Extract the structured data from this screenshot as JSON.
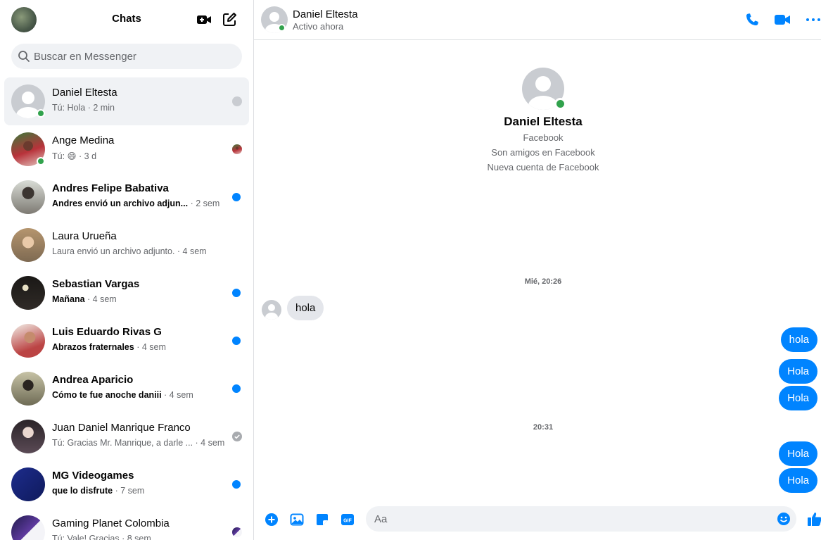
{
  "sidebar": {
    "title": "Chats",
    "search_placeholder": "Buscar en Messenger",
    "conversations": [
      {
        "name": "Daniel Eltesta",
        "message": "Tú: Hola",
        "time": "· 2 min",
        "online": true,
        "active": true,
        "unread": false,
        "status": "seen-avatar"
      },
      {
        "name": "Ange Medina",
        "message": "Tú: 😄",
        "time": "· 3 d",
        "online": true,
        "active": false,
        "unread": false,
        "status": "seen-avatar"
      },
      {
        "name": "Andres Felipe Babativa",
        "message": "Andres envió un archivo adjun...",
        "time": "· 2 sem",
        "online": false,
        "active": false,
        "unread": true,
        "status": "unread-dot"
      },
      {
        "name": "Laura Urueña",
        "message": "Laura envió un archivo adjunto.",
        "time": "· 4 sem",
        "online": false,
        "active": false,
        "unread": false,
        "status": "none"
      },
      {
        "name": "Sebastian Vargas",
        "message": "Mañana",
        "time": "· 4 sem",
        "online": false,
        "active": false,
        "unread": true,
        "status": "unread-dot"
      },
      {
        "name": "Luis Eduardo Rivas G",
        "message": "Abrazos fraternales",
        "time": "· 4 sem",
        "online": false,
        "active": false,
        "unread": true,
        "status": "unread-dot"
      },
      {
        "name": "Andrea Aparicio",
        "message": "Cómo te fue anoche daniii",
        "time": "· 4 sem",
        "online": false,
        "active": false,
        "unread": true,
        "status": "unread-dot"
      },
      {
        "name": "Juan Daniel Manrique Franco",
        "message": "Tú: Gracias Mr. Manrique, a darle ...",
        "time": "· 4 sem",
        "online": false,
        "active": false,
        "unread": false,
        "status": "delivered-check"
      },
      {
        "name": "MG Videogames",
        "message": "que lo disfrute",
        "time": "· 7 sem",
        "online": false,
        "active": false,
        "unread": true,
        "status": "unread-dot"
      },
      {
        "name": "Gaming Planet Colombia",
        "message": "Tú: Vale! Gracias",
        "time": "· 8 sem",
        "online": false,
        "active": false,
        "unread": false,
        "status": "seen-avatar"
      }
    ]
  },
  "chat": {
    "header": {
      "name": "Daniel Eltesta",
      "status": "Activo ahora"
    },
    "profile": {
      "name": "Daniel Eltesta",
      "lines": [
        "Facebook",
        "Son amigos en Facebook",
        "Nueva cuenta de Facebook"
      ]
    },
    "timestamps": [
      "Mié, 20:26",
      "20:31"
    ],
    "incoming": {
      "text": "hola"
    },
    "outgoing": [
      "hola",
      "Hola",
      "Hola",
      "Hola",
      "Hola"
    ],
    "composer_placeholder": "Aa"
  },
  "colors": {
    "accent": "#0084ff",
    "online": "#31a24c",
    "muted": "#65676b"
  }
}
